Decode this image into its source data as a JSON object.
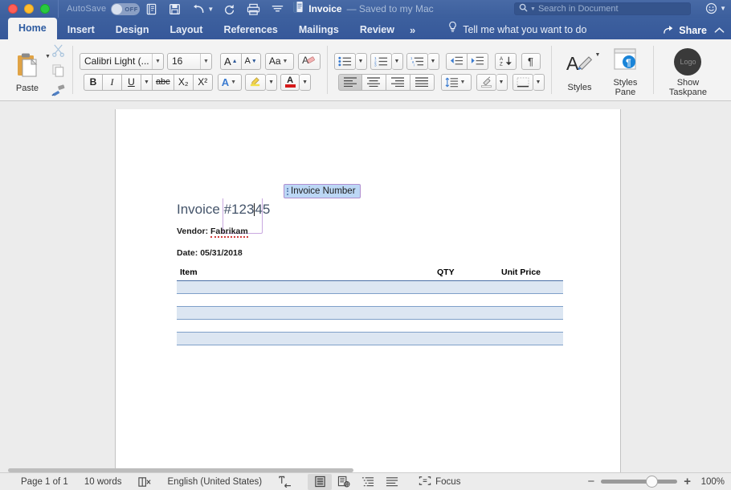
{
  "titlebar": {
    "autosave_label": "AutoSave",
    "autosave_state": "OFF",
    "doc_name": "Invoice",
    "save_state": "— Saved to my Mac",
    "icons": [
      "new-doc-icon",
      "save-icon",
      "undo-icon",
      "redo-icon",
      "print-icon",
      "customize-toolbar-icon"
    ],
    "search_placeholder": "Search in Document"
  },
  "tabs": [
    {
      "label": "Home",
      "active": true
    },
    {
      "label": "Insert",
      "active": false
    },
    {
      "label": "Design",
      "active": false
    },
    {
      "label": "Layout",
      "active": false
    },
    {
      "label": "References",
      "active": false
    },
    {
      "label": "Mailings",
      "active": false
    },
    {
      "label": "Review",
      "active": false
    }
  ],
  "tabs_overflow": "»",
  "tellme_label": "Tell me what you want to do",
  "share_label": "Share",
  "ribbon": {
    "paste_label": "Paste",
    "font_name": "Calibri Light (...",
    "font_size": "16",
    "grow_font": "A",
    "shrink_font": "A",
    "change_case": "Aa",
    "clear_formatting": "A",
    "bold": "B",
    "italic": "I",
    "underline": "U",
    "strikethrough": "abc",
    "subscript": "X₂",
    "superscript": "X²",
    "text_effects": "A",
    "highlight": "A",
    "font_color": "A",
    "styles_label": "Styles",
    "styles_pane_label": "Styles\nPane",
    "styles_pane_line1": "Styles",
    "styles_pane_line2": "Pane",
    "taskpane_line1": "Show",
    "taskpane_line2": "Taskpane",
    "taskpane_logo": "Logo"
  },
  "document": {
    "content_control_tag": "Invoice Number",
    "heading_prefix": "Invoice #",
    "invoice_number_before_caret": "123",
    "invoice_number_after_caret": "45",
    "vendor_label": "Vendor: ",
    "vendor_value": "Fabrikam",
    "date_label": "Date: ",
    "date_value": "05/31/2018",
    "table": {
      "headers": [
        "Item",
        "QTY",
        "Unit Price"
      ],
      "rows": [
        [
          "",
          "",
          ""
        ],
        [
          "",
          "",
          ""
        ],
        [
          "",
          "",
          ""
        ],
        [
          "",
          "",
          ""
        ],
        [
          "",
          "",
          ""
        ]
      ]
    }
  },
  "statusbar": {
    "page_label": "Page 1 of 1",
    "word_count": "10 words",
    "proofing_icon": "spelling-check-icon",
    "language": "English (United States)",
    "track_changes_icon": "track-changes-icon",
    "views": [
      "print-layout-view",
      "web-layout-view",
      "outline-view",
      "draft-view"
    ],
    "focus_label": "Focus",
    "zoom_out": "−",
    "zoom_in": "+",
    "zoom_level": "100%"
  },
  "colors": {
    "ribbon_blue": "#3a5d9b",
    "titlebar_blue": "#3f62a0",
    "accent_tab_text": "#2d5ba0",
    "heading_blue": "#44546a",
    "table_band": "#dce6f2",
    "table_border": "#7fa0c9",
    "cc_tag_bg": "#bcd7f5",
    "cc_border": "#b08fd0",
    "workspace_gray": "#ececec"
  }
}
